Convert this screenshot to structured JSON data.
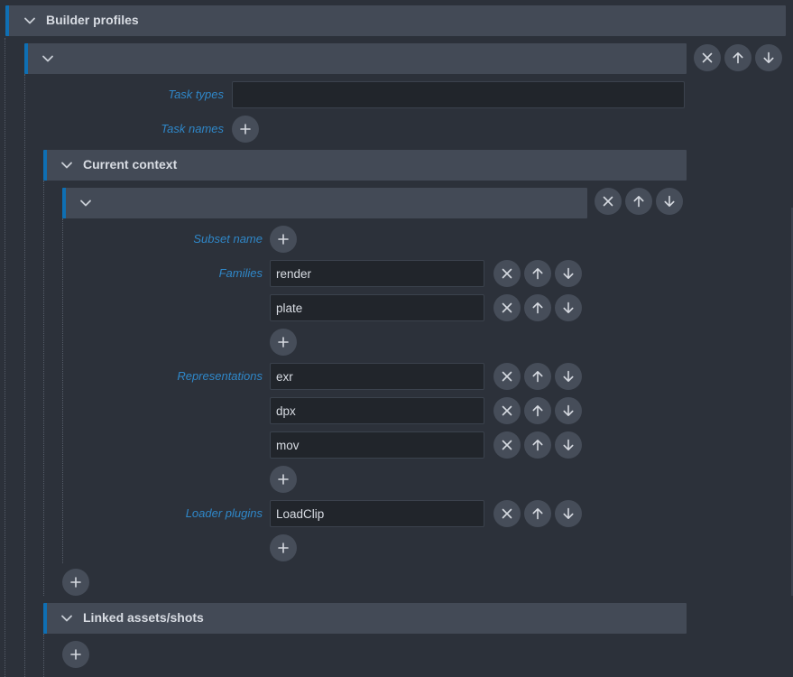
{
  "builder_profiles": {
    "title": "Builder profiles",
    "profile": {
      "title": "",
      "task_types": {
        "label": "Task types",
        "value": ""
      },
      "task_names": {
        "label": "Task names"
      },
      "current_context": {
        "title": "Current context",
        "item": {
          "title": "",
          "subset_name": {
            "label": "Subset name"
          },
          "families": {
            "label": "Families",
            "values": [
              "render",
              "plate"
            ]
          },
          "representations": {
            "label": "Representations",
            "values": [
              "exr",
              "dpx",
              "mov"
            ]
          },
          "loader_plugins": {
            "label": "Loader plugins",
            "values": [
              "LoadClip"
            ]
          }
        }
      },
      "linked_assets": {
        "title": "Linked assets/shots"
      }
    }
  },
  "icons": {
    "collapse": "chevron-down-icon",
    "remove": "close-icon",
    "move_up": "arrow-up-icon",
    "move_down": "arrow-down-icon",
    "add": "plus-icon"
  },
  "colors": {
    "background": "#2c313a",
    "header_bar": "#434a56",
    "accent": "#0f6fb3",
    "label": "#2f87c8",
    "input_bg": "#21252b",
    "button_bg": "#464d59"
  }
}
